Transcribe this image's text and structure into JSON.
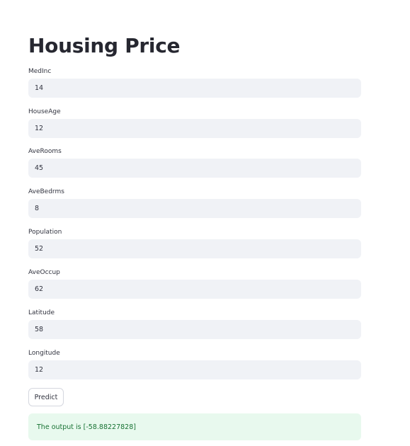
{
  "page": {
    "title": "Housing Price"
  },
  "fields": [
    {
      "label": "MedInc",
      "value": "14"
    },
    {
      "label": "HouseAge",
      "value": "12"
    },
    {
      "label": "AveRooms",
      "value": "45"
    },
    {
      "label": "AveBedrms",
      "value": "8"
    },
    {
      "label": "Population",
      "value": "52"
    },
    {
      "label": "AveOccup",
      "value": "62"
    },
    {
      "label": "Latitude",
      "value": "58"
    },
    {
      "label": "Longitude",
      "value": "12"
    }
  ],
  "actions": {
    "predict_label": "Predict"
  },
  "result": {
    "text": "The output is [-58.88227828]"
  },
  "colors": {
    "input_background": "#f0f2f6",
    "success_background": "#e8f9ee",
    "success_text": "#177233"
  }
}
